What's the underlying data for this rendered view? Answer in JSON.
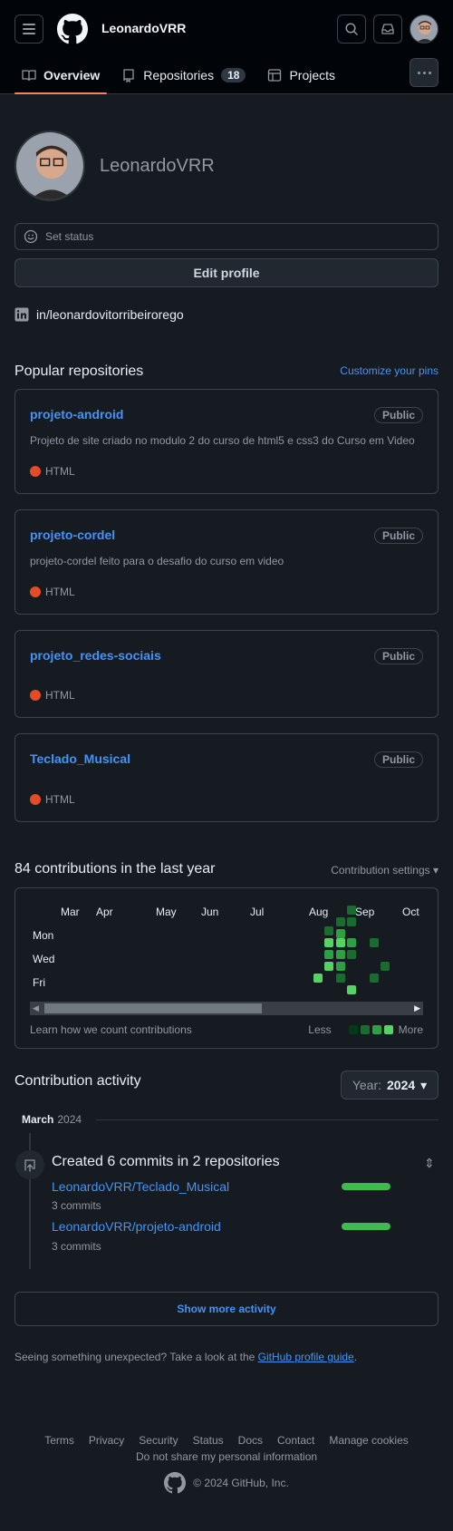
{
  "header": {
    "username": "LeonardoVRR",
    "icons": [
      "hamburger-icon",
      "github-logo",
      "search-icon",
      "inbox-icon",
      "avatar"
    ]
  },
  "tabs": [
    {
      "label": "Overview",
      "icon": "book-icon",
      "active": true
    },
    {
      "label": "Repositories",
      "icon": "repo-icon",
      "count": "18"
    },
    {
      "label": "Projects",
      "icon": "table-icon"
    }
  ],
  "profile": {
    "name": "LeonardoVRR",
    "status_placeholder": "Set status",
    "edit_label": "Edit profile",
    "linkedin": "in/leonardovitorribeirorego"
  },
  "popular": {
    "title": "Popular repositories",
    "customize": "Customize your pins",
    "repos": [
      {
        "name": "projeto-android",
        "visibility": "Public",
        "description": "Projeto de site criado no modulo 2 do curso de html5 e css3 do Curso em Video",
        "language": "HTML"
      },
      {
        "name": "projeto-cordel",
        "visibility": "Public",
        "description": "projeto-cordel feito para o desafio do curso em video",
        "language": "HTML"
      },
      {
        "name": "projeto_redes-sociais",
        "visibility": "Public",
        "description": "",
        "language": "HTML"
      },
      {
        "name": "Teclado_Musical",
        "visibility": "Public",
        "description": "",
        "language": "HTML"
      }
    ],
    "language_color": "#e34c26"
  },
  "contributions": {
    "title": "84 contributions in the last year",
    "settings": "Contribution settings",
    "months": [
      "Mar",
      "Apr",
      "May",
      "Jun",
      "Jul",
      "Aug",
      "Sep",
      "Oct"
    ],
    "days": [
      "Mon",
      "Wed",
      "Fri"
    ],
    "learn": "Learn how we count contributions",
    "less": "Less",
    "more": "More",
    "level_colors": [
      "#033a16",
      "#196c2e",
      "#2ea043",
      "#56d364"
    ]
  },
  "activity": {
    "title": "Contribution activity",
    "year_label": "Year:",
    "year": "2024",
    "month": "March",
    "month_year": "2024",
    "summary": "Created 6 commits in 2 repositories",
    "repos": [
      {
        "name": "LeonardoVRR/Teclado_Musical",
        "commits": "3 commits"
      },
      {
        "name": "LeonardoVRR/projeto-android",
        "commits": "3 commits"
      }
    ],
    "show_more": "Show more activity"
  },
  "guide": {
    "text": "Seeing something unexpected? Take a look at the",
    "link": "GitHub profile guide",
    "end": "."
  },
  "footer": {
    "links": [
      "Terms",
      "Privacy",
      "Security",
      "Status",
      "Docs",
      "Contact",
      "Manage cookies"
    ],
    "dns": "Do not share my personal information",
    "copyright": "© 2024 GitHub, Inc."
  }
}
